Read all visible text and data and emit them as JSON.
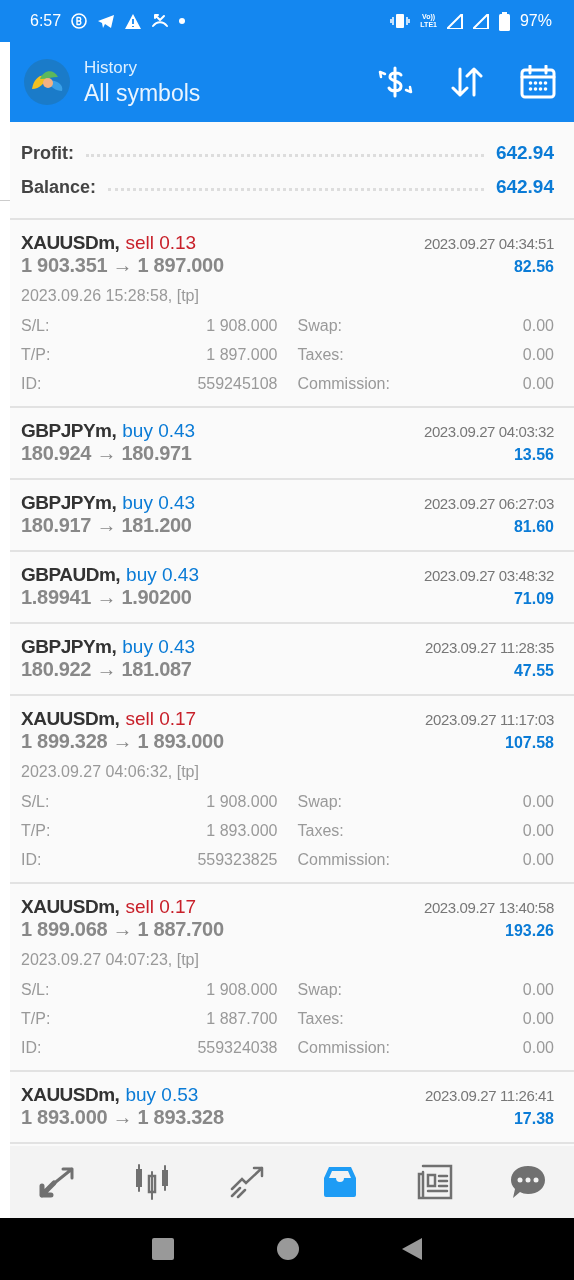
{
  "status_bar": {
    "time": "6:57",
    "network_lines": [
      "Vo))",
      "LTE1"
    ],
    "battery": "97%"
  },
  "header": {
    "title": "History",
    "subtitle": "All symbols"
  },
  "summary": [
    {
      "label": "Profit:",
      "value": "642.94"
    },
    {
      "label": "Balance:",
      "value": "642.94"
    }
  ],
  "trades": [
    {
      "symbol": "XAUUSDm,",
      "kind": "sell",
      "side": "sell 0.13",
      "time": "2023.09.27 04:34:51",
      "prices": "1 903.351 → 1 897.000",
      "profit": "82.56",
      "open_info": "2023.09.26 15:28:58, [tp]",
      "details": [
        [
          "S/L:",
          "1 908.000",
          "Swap:",
          "0.00"
        ],
        [
          "T/P:",
          "1 897.000",
          "Taxes:",
          "0.00"
        ],
        [
          "ID:",
          "559245108",
          "Commission:",
          "0.00"
        ]
      ]
    },
    {
      "symbol": "GBPJPYm,",
      "kind": "buy",
      "side": "buy 0.43",
      "time": "2023.09.27 04:03:32",
      "prices": "180.924 → 180.971",
      "profit": "13.56"
    },
    {
      "symbol": "GBPJPYm,",
      "kind": "buy",
      "side": "buy 0.43",
      "time": "2023.09.27 06:27:03",
      "prices": "180.917 → 181.200",
      "profit": "81.60"
    },
    {
      "symbol": "GBPAUDm,",
      "kind": "buy",
      "side": "buy 0.43",
      "time": "2023.09.27 03:48:32",
      "prices": "1.89941 → 1.90200",
      "profit": "71.09"
    },
    {
      "symbol": "GBPJPYm,",
      "kind": "buy",
      "side": "buy 0.43",
      "time": "2023.09.27 11:28:35",
      "prices": "180.922 → 181.087",
      "profit": "47.55"
    },
    {
      "symbol": "XAUUSDm,",
      "kind": "sell",
      "side": "sell 0.17",
      "time": "2023.09.27 11:17:03",
      "prices": "1 899.328 → 1 893.000",
      "profit": "107.58",
      "open_info": "2023.09.27 04:06:32, [tp]",
      "details": [
        [
          "S/L:",
          "1 908.000",
          "Swap:",
          "0.00"
        ],
        [
          "T/P:",
          "1 893.000",
          "Taxes:",
          "0.00"
        ],
        [
          "ID:",
          "559323825",
          "Commission:",
          "0.00"
        ]
      ]
    },
    {
      "symbol": "XAUUSDm,",
      "kind": "sell",
      "side": "sell 0.17",
      "time": "2023.09.27 13:40:58",
      "prices": "1 899.068 → 1 887.700",
      "profit": "193.26",
      "open_info": "2023.09.27 04:07:23, [tp]",
      "details": [
        [
          "S/L:",
          "1 908.000",
          "Swap:",
          "0.00"
        ],
        [
          "T/P:",
          "1 887.700",
          "Taxes:",
          "0.00"
        ],
        [
          "ID:",
          "559324038",
          "Commission:",
          "0.00"
        ]
      ]
    },
    {
      "symbol": "XAUUSDm,",
      "kind": "buy",
      "side": "buy 0.53",
      "time": "2023.09.27 11:26:41",
      "prices": "1 893.000 → 1 893.328",
      "profit": "17.38"
    }
  ],
  "bottom_nav": [
    {
      "kind": "quotes",
      "selected": false
    },
    {
      "kind": "chart",
      "selected": false
    },
    {
      "kind": "trade",
      "selected": false
    },
    {
      "kind": "history",
      "selected": true
    },
    {
      "kind": "news",
      "selected": false
    },
    {
      "kind": "chat",
      "selected": false
    }
  ]
}
